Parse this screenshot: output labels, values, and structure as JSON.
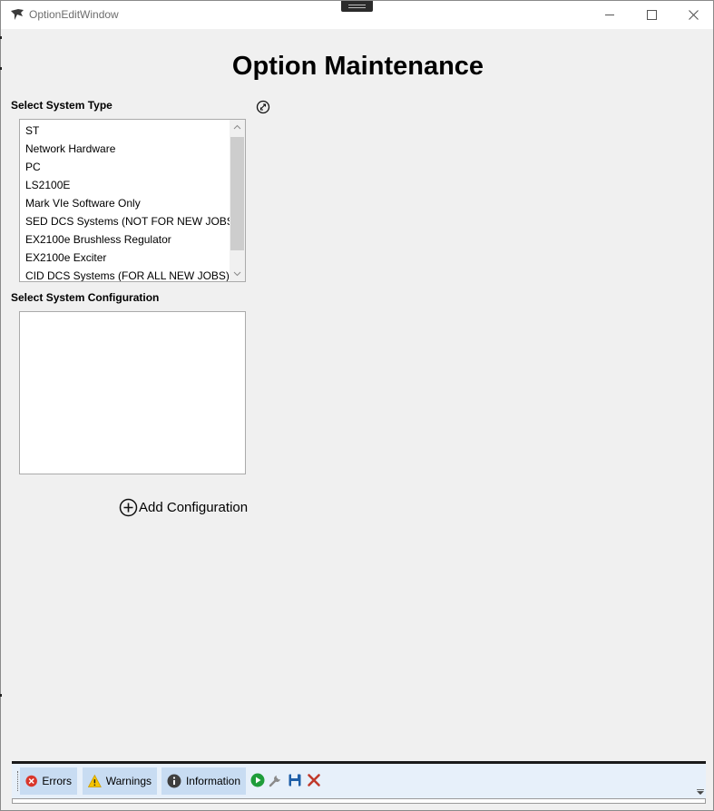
{
  "window": {
    "title": "OptionEditWindow"
  },
  "page": {
    "heading": "Option Maintenance"
  },
  "system_type": {
    "label": "Select System Type",
    "items": [
      "ST",
      "Network Hardware",
      "PC",
      "LS2100E",
      "Mark VIe Software Only",
      "SED DCS Systems (NOT FOR NEW JOBS)",
      "EX2100e Brushless Regulator",
      "EX2100e Exciter",
      "CID DCS Systems (FOR ALL NEW JOBS)"
    ]
  },
  "system_configuration": {
    "label": "Select System Configuration",
    "items": []
  },
  "add_configuration": {
    "label": "Add Configuration"
  },
  "status_bar": {
    "errors_label": "Errors",
    "warnings_label": "Warnings",
    "information_label": "Information"
  },
  "icons": {
    "app": "app-logo-icon",
    "refresh": "refresh-icon",
    "add": "plus-circle-icon",
    "error": "error-icon",
    "warning": "warning-icon",
    "info": "info-icon",
    "run": "play-icon",
    "settings": "wrench-icon",
    "save": "save-icon",
    "close": "close-icon"
  },
  "colors": {
    "window_background": "#f0f0f0",
    "status_background": "#e7f0fa",
    "status_button": "#c8dcf2",
    "error_red": "#d9362b",
    "warning_yellow": "#f5c400",
    "run_green": "#1f9d3a",
    "save_blue": "#1f5fa8"
  }
}
